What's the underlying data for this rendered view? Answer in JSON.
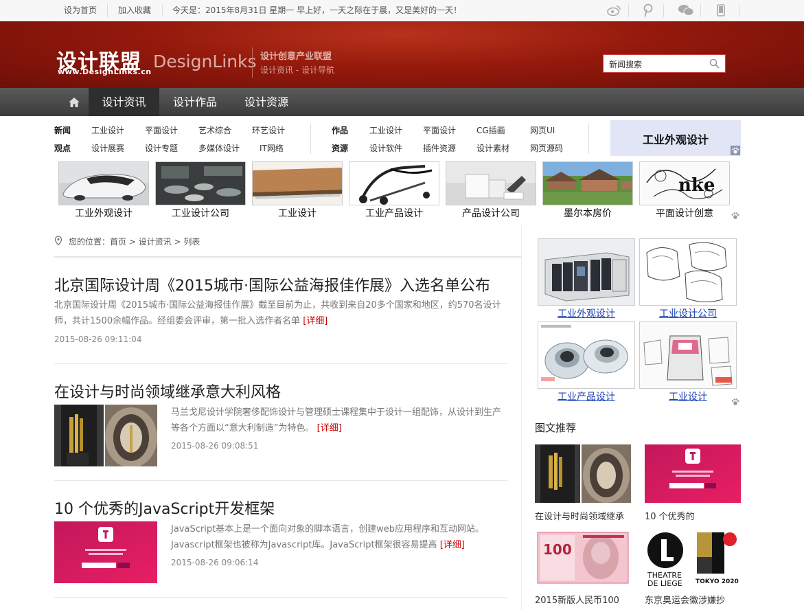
{
  "topbar": {
    "links": [
      "设为首页",
      "加入收藏"
    ],
    "date_text": "今天是：2015年8月31日 星期一 早上好，一天之际在于晨，又是美好的一天！",
    "social_icons": [
      "weibo-icon",
      "pinterest-icon",
      "wechat-icon",
      "mobile-icon"
    ]
  },
  "header": {
    "logo_cn": "设计联盟",
    "logo_url": "www.DesignLinks.cn",
    "logo_en": "DesignLinks",
    "tagline1": "设计创意产业联盟",
    "tagline2": "设计资讯 - 设计导航",
    "search_placeholder": "新闻搜索"
  },
  "nav": {
    "items": [
      "设计资讯",
      "设计作品",
      "设计资源"
    ],
    "active": "设计资讯"
  },
  "subnav": {
    "group1": [
      {
        "label": "新闻",
        "items": [
          "工业设计",
          "平面设计",
          "艺术综合",
          "环艺设计"
        ]
      },
      {
        "label": "观点",
        "items": [
          "设计展赛",
          "设计专题",
          "多媒体设计",
          "IT网络"
        ]
      }
    ],
    "group2": [
      {
        "label": "作品",
        "items": [
          "工业设计",
          "平面设计",
          "CG插画",
          "网页UI"
        ]
      },
      {
        "label": "资源",
        "items": [
          "设计软件",
          "插件资源",
          "设计素材",
          "网页源码"
        ]
      }
    ],
    "ad_text": "工业外观设计"
  },
  "thumbs": [
    "工业外观设计",
    "工业设计公司",
    "工业设计",
    "工业产品设计",
    "产品设计公司",
    "墨尔本房价",
    "平面设计创意"
  ],
  "breadcrumb": {
    "prefix": "您的位置：",
    "path": "首页 > 设计资讯 > 列表"
  },
  "articles": [
    {
      "title": "北京国际设计周《2015城市·国际公益海报佳作展》入选名单公布",
      "summary": "北京国际设计周《2015城市·国际公益海报佳作展》截至目前为止，共收到来自20多个国家和地区，约570名设计师，共计1500余幅作品。经组委会评审，第一批入选作者名单",
      "more": "[详细]",
      "date": "2015-08-26 09:11:04"
    },
    {
      "title": "在设计与时尚领域继承意大利风格",
      "summary": "马兰戈尼设计学院奢侈配饰设计与管理硕士课程集中于设计一组配饰，从设计到生产等各个方面以“意大利制造”为特色。",
      "more": "[详细]",
      "date": "2015-08-26 09:08:51"
    },
    {
      "title": "10 个优秀的JavaScript开发框架",
      "summary": "JavaScript基本上是一个面向对象的脚本语言，创建web应用程序和互动网站。Javascript框架也被称为Javascript库。JavaScript框架很容易提高",
      "more": "[详细]",
      "date": "2015-08-26 09:06:14"
    }
  ],
  "sidebar": {
    "grid": [
      "工业外观设计",
      "工业设计公司",
      "工业产品设计",
      "工业设计"
    ],
    "recommend_title": "图文推荐",
    "recommend": [
      "在设计与时尚领域继承",
      "10 个优秀的",
      "2015新版人民币100",
      "东京奥运会徽涉嫌抄"
    ]
  },
  "colors": {
    "header_red": "#94190c",
    "nav_dark": "#3b3b3b",
    "link_blue": "#1a3fb6",
    "more_red": "#cc0000",
    "ad_bg": "#e1e5f5"
  }
}
